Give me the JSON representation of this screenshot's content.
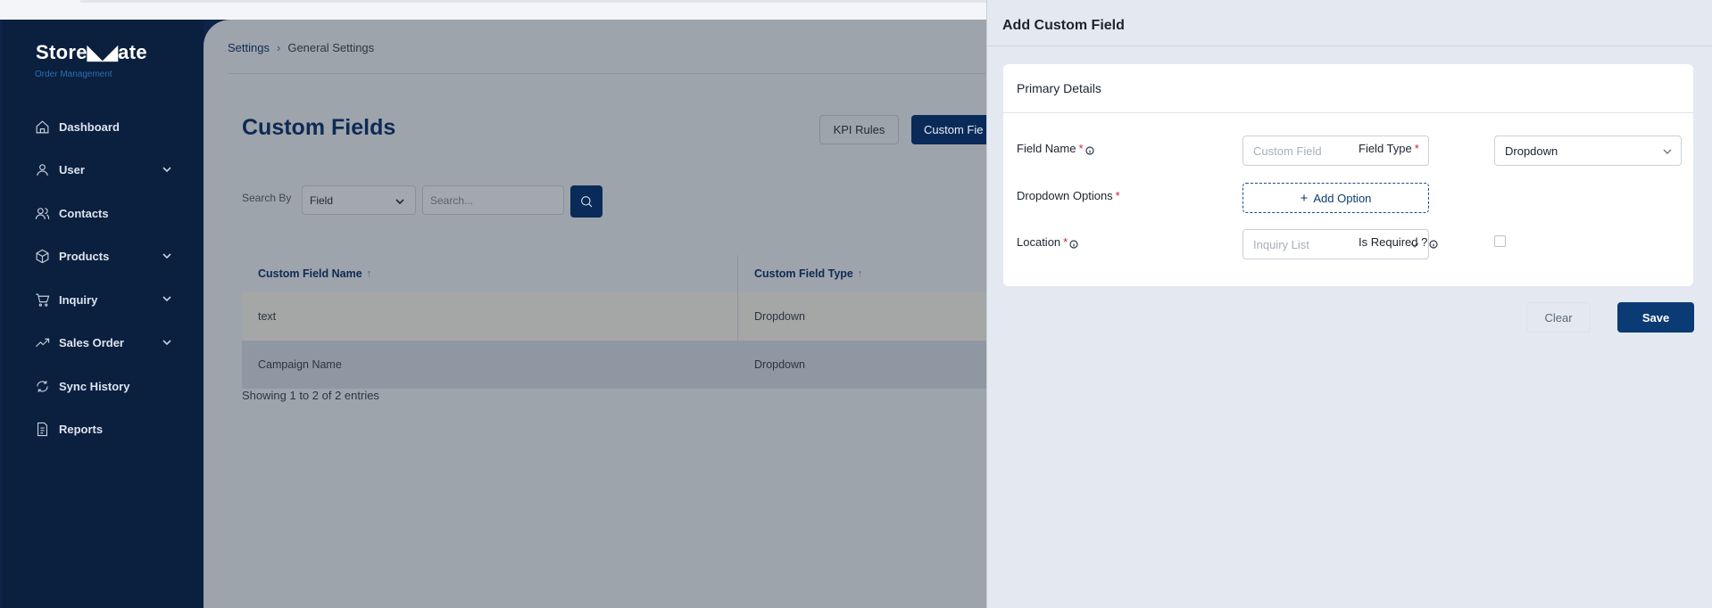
{
  "sidebar": {
    "logo": "Store◣◢ate",
    "logo_sub": "Order Management",
    "items": [
      {
        "label": "Dashboard",
        "icon": "home-icon"
      },
      {
        "label": "User",
        "icon": "user-icon",
        "has_chevron": true
      },
      {
        "label": "Contacts",
        "icon": "users-icon"
      },
      {
        "label": "Products",
        "icon": "box-icon",
        "has_chevron": true
      },
      {
        "label": "Inquiry",
        "icon": "cart-icon",
        "has_chevron": true
      },
      {
        "label": "Sales Order",
        "icon": "trend-icon",
        "has_chevron": true
      },
      {
        "label": "Sync History",
        "icon": "sync-icon"
      },
      {
        "label": "Reports",
        "icon": "report-icon"
      }
    ]
  },
  "breadcrumb": {
    "parent": "Settings",
    "current": "General Settings"
  },
  "main": {
    "title": "Custom Fields",
    "tabs": {
      "kpi": "KPI Rules",
      "custom": "Custom Fie"
    },
    "search": {
      "label": "Search By",
      "field_value": "Field",
      "placeholder": "Search..."
    },
    "table": {
      "headers": [
        "Custom Field Name",
        "Custom Field Type"
      ],
      "rows": [
        [
          "text",
          "Dropdown"
        ],
        [
          "Campaign Name",
          "Dropdown"
        ]
      ]
    },
    "showing": "Showing 1 to 2 of 2  entries"
  },
  "drawer": {
    "title": "Add Custom Field",
    "section_title": "Primary Details",
    "field_name_label": "Field Name",
    "field_name_placeholder": "Custom Field",
    "field_type_label": "Field Type",
    "field_type_value": "Dropdown",
    "dropdown_options_label": "Dropdown Options",
    "add_option_label": "Add Option",
    "location_label": "Location",
    "location_placeholder": "Inquiry List",
    "is_required_label": "Is Required ?",
    "clear_label": "Clear",
    "save_label": "Save",
    "required_mark": "*"
  },
  "colors": {
    "primary": "#0b3b74",
    "sidebar": "#0b1f3e",
    "required": "#d0213b"
  }
}
